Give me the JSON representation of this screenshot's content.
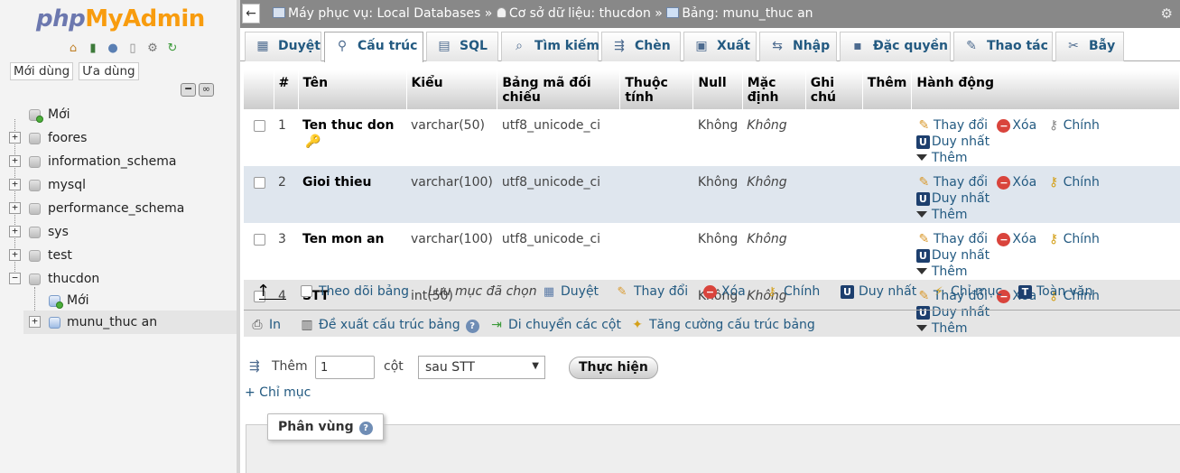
{
  "nav": {
    "logo_php": "php",
    "logo_myadmin": "MyAdmin",
    "recent_label": "Mới dùng",
    "favorites_label": "Ưa dùng",
    "icons": [
      "home-icon",
      "logout-icon",
      "help-icon",
      "docs-icon",
      "settings-icon",
      "reload-icon"
    ],
    "tree": [
      {
        "label": "Mới",
        "type": "new"
      },
      {
        "label": "foores",
        "type": "db"
      },
      {
        "label": "information_schema",
        "type": "db"
      },
      {
        "label": "mysql",
        "type": "db"
      },
      {
        "label": "performance_schema",
        "type": "db"
      },
      {
        "label": "sys",
        "type": "db"
      },
      {
        "label": "test",
        "type": "db"
      },
      {
        "label": "thucdon",
        "type": "db-open"
      }
    ],
    "sub_new": "Mới",
    "sub_table": "munu_thuc an"
  },
  "breadcrumb": {
    "server": "Máy phục vụ: Local Databases",
    "sep": "»",
    "database": "Cơ sở dữ liệu: thucdon",
    "table": "Bảng: munu_thuc an"
  },
  "tabs": [
    {
      "label": "Duyệt",
      "icon": "▦"
    },
    {
      "label": "Cấu trúc",
      "icon": "⚲"
    },
    {
      "label": "SQL",
      "icon": "▤"
    },
    {
      "label": "Tìm kiếm",
      "icon": "🔍"
    },
    {
      "label": "Chèn",
      "icon": "⇶"
    },
    {
      "label": "Xuất",
      "icon": "▣"
    },
    {
      "label": "Nhập",
      "icon": "⇆"
    },
    {
      "label": "Đặc quyền",
      "icon": "▪"
    },
    {
      "label": "Thao tác",
      "icon": "🔧"
    },
    {
      "label": "Bẫy",
      "icon": "✂"
    }
  ],
  "table": {
    "headers": {
      "num": "#",
      "name": "Tên",
      "type": "Kiểu",
      "collation": "Bảng mã đối chiếu",
      "attributes": "Thuộc tính",
      "null": "Null",
      "default": "Mặc định",
      "comment": "Ghi chú",
      "extra": "Thêm",
      "action": "Hành động"
    },
    "rows": [
      {
        "num": "1",
        "name": "Ten thuc don",
        "type": "varchar(50)",
        "collation": "utf8_unicode_ci",
        "null": "Không",
        "default": "Không"
      },
      {
        "num": "2",
        "name": "Gioi thieu",
        "type": "varchar(100)",
        "collation": "utf8_unicode_ci",
        "null": "Không",
        "default": "Không"
      },
      {
        "num": "3",
        "name": "Ten mon an",
        "type": "varchar(100)",
        "collation": "utf8_unicode_ci",
        "null": "Không",
        "default": "Không"
      },
      {
        "num": "4",
        "name": "STT",
        "type": "int(50)",
        "collation": "",
        "null": "Không",
        "default": "Không"
      }
    ],
    "actions": {
      "change": "Thay đổi",
      "drop": "Xóa",
      "primary": "Chính",
      "unique": "Duy nhất",
      "more": "Thêm"
    }
  },
  "bulk": {
    "check_all": "Theo dõi bảng",
    "with_selected": "Lưu mục đã chọn",
    "browse": "Duyệt",
    "change": "Thay đổi",
    "drop": "Xóa",
    "primary": "Chính",
    "unique": "Duy nhất",
    "index": "Chỉ mục",
    "fulltext": "Toàn văn"
  },
  "links": {
    "print": "In",
    "propose": "Đề xuất cấu trúc bảng",
    "move_columns": "Di chuyển các cột",
    "improve": "Tăng cường cấu trúc bảng"
  },
  "add_column": {
    "label_add": "Thêm",
    "count": "1",
    "label_cols": "cột",
    "position": "sau STT",
    "go": "Thực hiện"
  },
  "add_index": "+ Chỉ mục",
  "partition_title": "Phân vùng"
}
